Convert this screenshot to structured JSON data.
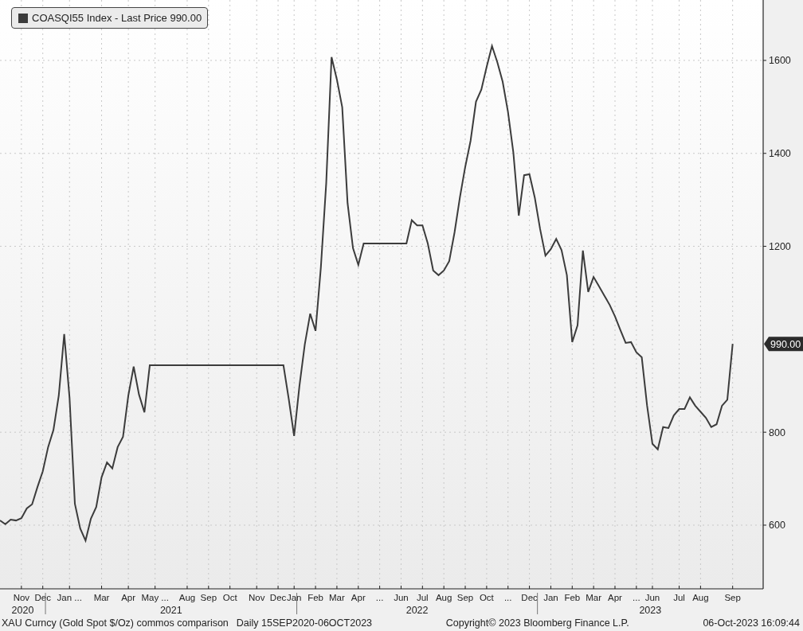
{
  "legend": {
    "suffix": "- Last Price 990.00"
  },
  "last_price_tag": "990.00",
  "year_labels": [
    "2020",
    "2021",
    "2022",
    "2023"
  ],
  "chart_data": {
    "type": "line",
    "grid": true,
    "ylim": [
      463,
      1730
    ],
    "yticks": [
      600,
      800,
      1200,
      1400,
      1600
    ],
    "categories": [
      null,
      null,
      null,
      null,
      "Nov",
      null,
      null,
      null,
      "Dec",
      null,
      null,
      null,
      null,
      "Jan ...",
      null,
      null,
      null,
      null,
      null,
      "Mar",
      null,
      null,
      null,
      null,
      "Apr",
      null,
      null,
      null,
      null,
      "May ...",
      null,
      null,
      null,
      null,
      null,
      "Aug",
      null,
      null,
      null,
      "Sep",
      null,
      null,
      null,
      "Oct",
      null,
      null,
      null,
      null,
      "Nov",
      null,
      null,
      null,
      "Dec",
      null,
      null,
      "Jan",
      null,
      null,
      null,
      "Feb",
      null,
      null,
      null,
      "Mar",
      null,
      null,
      null,
      "Apr",
      null,
      null,
      null,
      "...",
      null,
      null,
      null,
      "Jun",
      null,
      null,
      null,
      "Jul",
      null,
      null,
      null,
      "Aug",
      null,
      null,
      null,
      "Sep",
      null,
      null,
      null,
      "Oct",
      null,
      null,
      null,
      "...",
      null,
      null,
      null,
      "Dec",
      null,
      null,
      null,
      "Jan",
      null,
      null,
      null,
      "Feb",
      null,
      null,
      null,
      "Mar",
      null,
      null,
      null,
      "Apr",
      null,
      null,
      null,
      "...",
      null,
      null,
      "Jun",
      null,
      null,
      null,
      null,
      "Jul",
      null,
      null,
      null,
      "Aug",
      null,
      null,
      null,
      null,
      null,
      "Sep"
    ],
    "series": [
      {
        "name": "COASQI55 Index",
        "color": "#3c3c3c",
        "values": [
          610,
          602,
          612,
          610,
          615,
          636,
          645,
          682,
          716,
          768,
          805,
          879,
          1011,
          874,
          646,
          593,
          567,
          614,
          639,
          703,
          735,
          722,
          768,
          790,
          879,
          941,
          881,
          843,
          944,
          944,
          944,
          944,
          944,
          944,
          944,
          944,
          944,
          944,
          944,
          944,
          944,
          944,
          944,
          944,
          944,
          944,
          944,
          944,
          944,
          944,
          944,
          944,
          944,
          944,
          871,
          792,
          900,
          989,
          1055,
          1018,
          1155,
          1336,
          1607,
          1559,
          1499,
          1293,
          1196,
          1160,
          1206,
          1206,
          1206,
          1206,
          1206,
          1206,
          1206,
          1206,
          1206,
          1256,
          1245,
          1245,
          1206,
          1148,
          1138,
          1148,
          1168,
          1230,
          1305,
          1371,
          1427,
          1511,
          1537,
          1586,
          1631,
          1596,
          1554,
          1489,
          1402,
          1266,
          1353,
          1355,
          1305,
          1237,
          1180,
          1194,
          1216,
          1192,
          1138,
          994,
          1030,
          1191,
          1102,
          1134,
          1114,
          1094,
          1074,
          1049,
          1020,
          992,
          994,
          972,
          961,
          857,
          775,
          763,
          811,
          809,
          836,
          850,
          850,
          875,
          857,
          844,
          831,
          811,
          817,
          857,
          870,
          990
        ]
      }
    ]
  },
  "footer": {
    "description": "XAU Curncy (Gold Spot  $/Oz) commos comparison",
    "range": "Daily 15SEP2020-06OCT2023",
    "copyright": "Copyright© 2023 Bloomberg Finance L.P.",
    "timestamp": "06-Oct-2023 16:09:44"
  }
}
